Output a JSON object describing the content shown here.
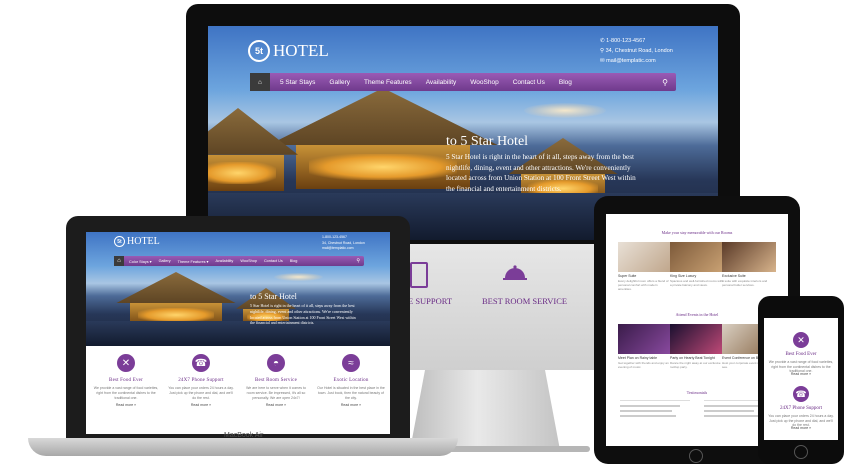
{
  "hotel": {
    "logo_badge": "5t",
    "logo_text": "HOTEL",
    "contact": {
      "phone": "1-800-123-4567",
      "address": "34, Chestnut Road, London",
      "email": "mail@templatic.com"
    },
    "nav": [
      "5 Star Stays",
      "Gallery",
      "Theme Features",
      "Availability",
      "WooShop",
      "Contact Us",
      "Blog"
    ],
    "mac_nav": [
      "Color Stays ▾",
      "Gallery",
      "Theme Features ▾",
      "Availability",
      "WooShop",
      "Contact Us",
      "Blog"
    ],
    "hero_title": "to 5 Star Hotel",
    "hero_text": "5 Star Hotel is right in the heart of it all, steps away from the best nightlife, dining, event and other attractions. We're conveniently located across from Union Station at 100 Front Street West within the financial and entertainment districts."
  },
  "imac_below": {
    "support_label": "E SUPPORT",
    "room_service_label": "BEST ROOM SERVICE"
  },
  "macbook": {
    "label": "MacBook Air",
    "features": [
      {
        "title": "Best Food Ever",
        "desc": "We provide a vast range of food varieties, right from the continental dishes to the traditional one.",
        "more": "Read more »"
      },
      {
        "title": "24X7 Phone Support",
        "desc": "You can place your orders 24 hours a day. Just pick up the phone and dial, and we'll do the rest.",
        "more": "Read more »"
      },
      {
        "title": "Best Room Service",
        "desc": "We are here to serve when it comes to room service. Be impressed, it's all so personally. We are open 24x7!",
        "more": "Read more »"
      },
      {
        "title": "Exotic Location",
        "desc": "Our Hotel is situated in the best place in the town. Just book, then the natural beauty of the city.",
        "more": "Read more »"
      }
    ]
  },
  "ipad": {
    "heading1": "Make your stay memorable with our Rooms",
    "cards1": [
      {
        "title": "Super Suite",
        "desc": "Every delightful room offers a blend of personal comfort with modern amenities."
      },
      {
        "title": "King Size Luxury",
        "desc": "Spacious and well-furnished rooms with a private balcony and views."
      },
      {
        "title": "Exclusive Suite",
        "desc": "A suite with exquisite interiors and personal butler services."
      }
    ],
    "heading2": "Attend Events in the Hotel",
    "cards2": [
      {
        "title": "Meet Plan on Rainy table",
        "desc": "Get together with friends and enjoy an evening of music."
      },
      {
        "title": "Party on Hearty Beat Tonight",
        "desc": "Dance the night away at our exclusive rooftop party."
      },
      {
        "title": "Event Conference on Beach",
        "desc": "Host your corporate event right by the sea."
      }
    ],
    "testimonials_title": "Testimonials"
  },
  "iphone": {
    "items": [
      {
        "title": "Best Food Ever",
        "desc": "We provide a vast range of food varieties, right from the continental dishes to the traditional one.",
        "more": "Read more »"
      },
      {
        "title": "24X7 Phone Support",
        "desc": "You can place your orders 24 hours a day. Just pick up the phone and dial, and we'll do the rest.",
        "more": "Read more »"
      }
    ]
  },
  "icons": {
    "home": "home-icon",
    "search": "search-icon",
    "phone": "phone-icon",
    "map_marker": "map-marker-icon",
    "mail": "mail-icon",
    "food": "fork-knife-icon",
    "support": "phone-support-icon",
    "room_service": "cloche-icon",
    "location": "swimmer-icon",
    "apple": "apple-logo-icon"
  },
  "colors": {
    "nav_purple": "#7b3d98",
    "heading_purple": "#6a2c86"
  }
}
